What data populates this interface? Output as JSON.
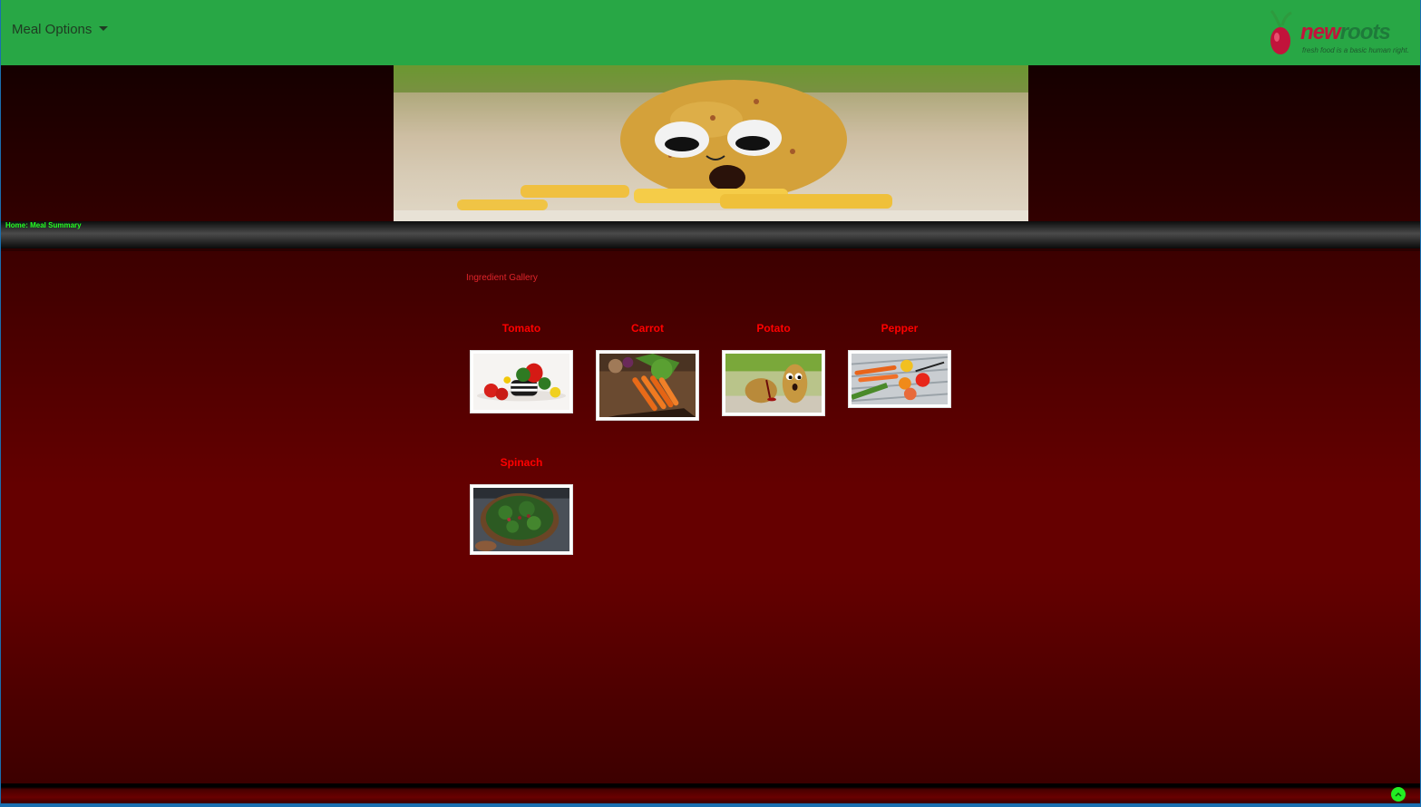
{
  "navbar": {
    "dropdown_label": "Meal Options",
    "logo": {
      "word1": "new",
      "word2": "roots",
      "tagline": "fresh food is a basic human right."
    }
  },
  "breadcrumb": "Home: Meal Summary",
  "gallery": {
    "title": "Ingredient Gallery",
    "items": [
      {
        "name": "Tomato"
      },
      {
        "name": "Carrot"
      },
      {
        "name": "Potato"
      },
      {
        "name": "Pepper"
      },
      {
        "name": "Spinach"
      }
    ]
  },
  "colors": {
    "navbar": "#28a745",
    "label": "#ff0000",
    "breadcrumb_text": "#22ff22",
    "main_bg": "#650000"
  },
  "icons": {
    "dropdown": "caret-down-icon",
    "scroll_top": "chevron-up-icon"
  }
}
